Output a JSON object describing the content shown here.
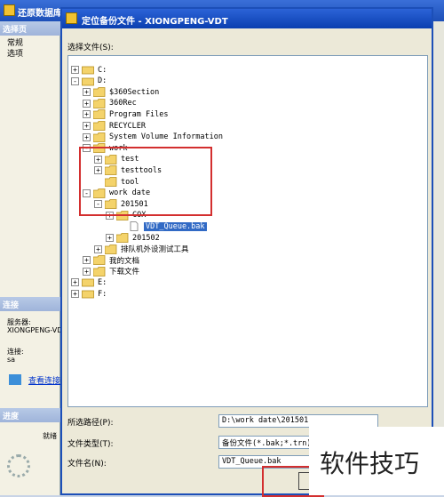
{
  "background": {
    "title": "还原数据库 - WDT",
    "left_panel": {
      "select_page_header": "选择页",
      "pages": [
        "常规",
        "选项"
      ],
      "connection_header": "连接",
      "server_label": "服务器:",
      "server_value": "XIONGPENG-VD",
      "connection_label": "连接:",
      "connection_value": "sa",
      "view_link": "查看连接",
      "progress_header": "进度",
      "progress_status": "就绪"
    }
  },
  "dialog": {
    "title": "定位备份文件 - XIONGPENG-VDT",
    "select_file_label": "选择文件(S):",
    "tree": [
      {
        "label": "C:",
        "expander": "+"
      },
      {
        "label": "D:",
        "expander": "-"
      },
      {
        "label": "$360Section",
        "expander": "+"
      },
      {
        "label": "360Rec",
        "expander": "+"
      },
      {
        "label": "Program Files",
        "expander": "+"
      },
      {
        "label": "RECYCLER",
        "expander": "+"
      },
      {
        "label": "System Volume Information",
        "expander": "+"
      },
      {
        "label": "work",
        "expander": "-"
      },
      {
        "label": "test",
        "expander": "+"
      },
      {
        "label": "testtools",
        "expander": "+"
      },
      {
        "label": "tool",
        "expander": ""
      },
      {
        "label": "work date",
        "expander": "-"
      },
      {
        "label": "201501",
        "expander": "-"
      },
      {
        "label": "COX",
        "expander": "+"
      },
      {
        "label": "VDT_Queue.bak",
        "expander": ""
      },
      {
        "label": "201502",
        "expander": "+"
      },
      {
        "label": "排队机外设测试工具",
        "expander": "+"
      },
      {
        "label": "我的文档",
        "expander": "+"
      },
      {
        "label": "下载文件",
        "expander": "+"
      },
      {
        "label": "E:",
        "expander": "+"
      },
      {
        "label": "F:",
        "expander": "+"
      }
    ],
    "path_label": "所选路径(P):",
    "path_value": "D:\\work date\\201501",
    "type_label": "文件类型(T):",
    "type_value": "备份文件(*.bak;*.trn)",
    "name_label": "文件名(N):",
    "name_value": "VDT_Queue.bak"
  },
  "watermark": "软件技巧"
}
